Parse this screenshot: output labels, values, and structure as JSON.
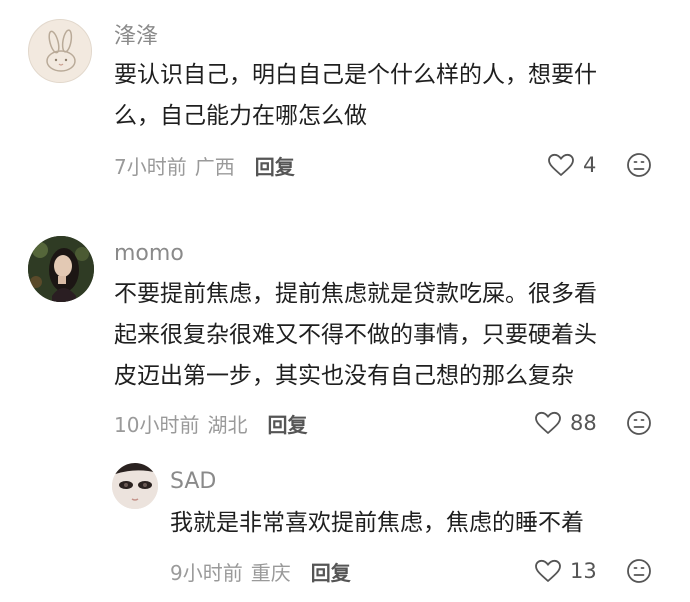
{
  "comments": [
    {
      "username": "浲浲",
      "lines": [
        "要认识自己，明白自己是个什么样的人，想要什",
        "么，自己能力在哪怎么做"
      ],
      "time": "7小时前",
      "location": "广西",
      "reply_label": "回复",
      "likes": "4"
    },
    {
      "username": "momo",
      "lines": [
        "不要提前焦虑，提前焦虑就是贷款吃屎。很多看",
        "起来很复杂很难又不得不做的事情，只要硬着头",
        "皮迈出第一步，其实也没有自己想的那么复杂"
      ],
      "time": "10小时前",
      "location": "湖北",
      "reply_label": "回复",
      "likes": "88"
    }
  ],
  "replies": [
    {
      "username": "SAD",
      "lines": [
        "我就是非常喜欢提前焦虑，焦虑的睡不着"
      ],
      "time": "9小时前",
      "location": "重庆",
      "reply_label": "回复",
      "likes": "13"
    }
  ],
  "icons": {
    "like": "heart-outline-icon",
    "dislike": "frown-face-icon"
  },
  "colors": {
    "username": "#8a8a8a",
    "meta": "#9a9a9a",
    "text": "#1f1f1f"
  }
}
